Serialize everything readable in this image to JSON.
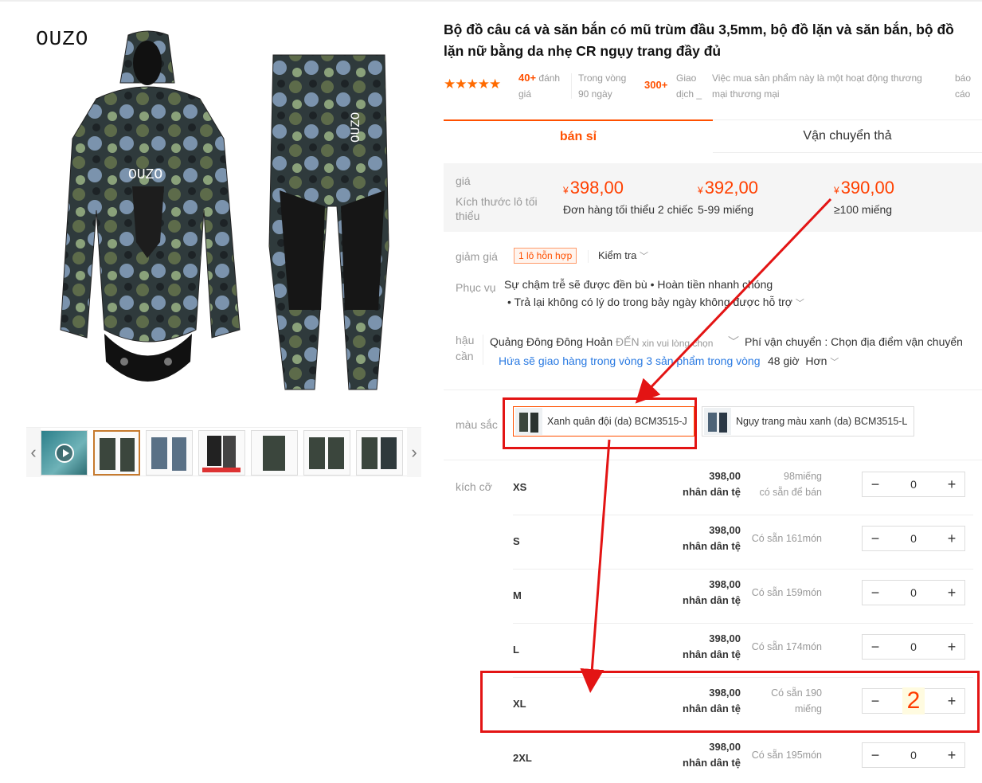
{
  "brand": "OUZO",
  "suit_logo": "OUZO",
  "title": "Bộ đồ câu cá và săn bắn có mũ trùm đầu 3,5mm, bộ đồ lặn và săn bắn, bộ đồ lặn nữ bằng da nhẹ CR ngụy trang đầy đủ",
  "rating": {
    "stars": "★★★★★",
    "reviews_count": "40+",
    "reviews_label_1": "đánh",
    "reviews_label_2": "giá",
    "period_1": "Trong vòng",
    "period_2": "90 ngày",
    "transactions_count": "300+",
    "transactions_label_1": "Giao",
    "transactions_label_2": "dịch _",
    "notice_1": "Việc mua sản phẩm này là một hoạt động thương",
    "notice_2": "mại thương mại",
    "report_1": "báo",
    "report_2": "cáo"
  },
  "tabs": {
    "wholesale": "bán sỉ",
    "shipping": "Vận chuyển thả"
  },
  "price_box": {
    "label_price": "giá",
    "label_moq": "Kích thước lô tối thiểu",
    "currency": "¥",
    "tiers": [
      {
        "price": "398,00",
        "qty": "Đơn hàng tối thiểu 2 chiếc"
      },
      {
        "price": "392,00",
        "qty": "5-99 miếng"
      },
      {
        "price": "390,00",
        "qty": "≥100 miếng"
      }
    ]
  },
  "discount": {
    "label": "giảm giá",
    "tag": "1 lô hỗn hợp",
    "check": "Kiểm tra"
  },
  "service": {
    "label": "Phục vụ",
    "line1": "Sự chậm trễ sẽ được đền bù • Hoàn tiền nhanh chóng",
    "line2": "• Trả lại không có lý do trong bảy ngày không được hỗ trợ"
  },
  "logistics": {
    "label_1": "hậu",
    "label_2": "cần",
    "origin": "Quảng Đông Đông Hoản",
    "to": "ĐẾN",
    "choose": "xin vui lòng chọn",
    "fee": "Phí vận chuyển : Chọn địa điểm vận chuyển",
    "promise": "Hứa sẽ giao hàng trong vòng 3 sản phẩm trong vòng",
    "hours": "48 giờ",
    "more": "Hơn"
  },
  "color": {
    "label": "màu sắc",
    "options": [
      {
        "name": "Xanh quân đội (da) BCM3515-J",
        "selected": true
      },
      {
        "name": "Ngụy trang màu xanh (da) BCM3515-L",
        "selected": false
      }
    ]
  },
  "sizes": {
    "label": "kích cỡ",
    "unit": "nhân dân tệ",
    "rows": [
      {
        "size": "XS",
        "price": "398,00",
        "stock_1": "98miếng",
        "stock_2": "có sẵn để bán",
        "qty": "0"
      },
      {
        "size": "S",
        "price": "398,00",
        "stock_1": "Có sẵn 161món",
        "stock_2": "",
        "qty": "0"
      },
      {
        "size": "M",
        "price": "398,00",
        "stock_1": "Có sẵn 159món",
        "stock_2": "",
        "qty": "0"
      },
      {
        "size": "L",
        "price": "398,00",
        "stock_1": "Có sẵn 174món",
        "stock_2": "",
        "qty": "0"
      },
      {
        "size": "XL",
        "price": "398,00",
        "stock_1": "Có sẵn 190",
        "stock_2": "miếng",
        "qty": "2"
      },
      {
        "size": "2XL",
        "price": "398,00",
        "stock_1": "Có sẵn 195món",
        "stock_2": "",
        "qty": "0"
      }
    ]
  },
  "stepper": {
    "minus": "−",
    "plus": "+"
  },
  "colors": {
    "accent": "#ff5000",
    "annotation": "#e31414",
    "price": "#ff4000"
  }
}
